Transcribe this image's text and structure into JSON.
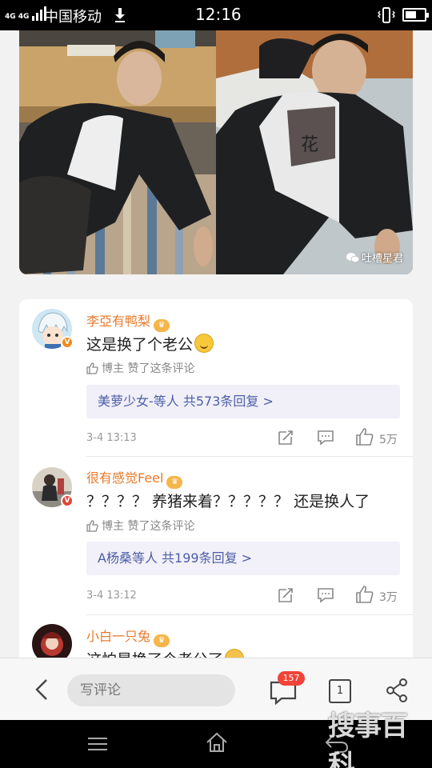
{
  "status_bar": {
    "network": "4G 4G",
    "carrier": "中国移动",
    "time": "12:16",
    "battery_level": 0.6,
    "icons": [
      "signal-icon",
      "download-icon",
      "vibrate-icon",
      "battery-icon"
    ]
  },
  "photo": {
    "watermark": "吐槽星君"
  },
  "comments": [
    {
      "username": "李亞有鸭梨",
      "badge": "V",
      "text": "这是换了个老公",
      "has_emoji": true,
      "liked_by_author": "博主 赞了这条评论",
      "replies_label": "美萝少女-等人 共573条回复 >",
      "timestamp": "3-4 13:13",
      "like_count": "5万"
    },
    {
      "username": "很有感觉Feel",
      "badge": "V",
      "text": "？？？？ 养猪来着？？？？？  还是换人了",
      "has_emoji": false,
      "liked_by_author": "博主 赞了这条评论",
      "replies_label": "A杨桑等人 共199条回复 >",
      "timestamp": "3-4 13:12",
      "like_count": "3万"
    },
    {
      "username": "小白一只兔",
      "badge": "V",
      "text": "这怕是换了个老公了",
      "has_emoji": true
    }
  ],
  "bottom_bar": {
    "write_placeholder": "写评论",
    "comment_count": "157",
    "tab_count": "1"
  },
  "corner_watermark": "搜事百科",
  "colors": {
    "username": "#e87a2b",
    "reply_link": "#4d5ea8",
    "badge_red": "#f0443a"
  }
}
